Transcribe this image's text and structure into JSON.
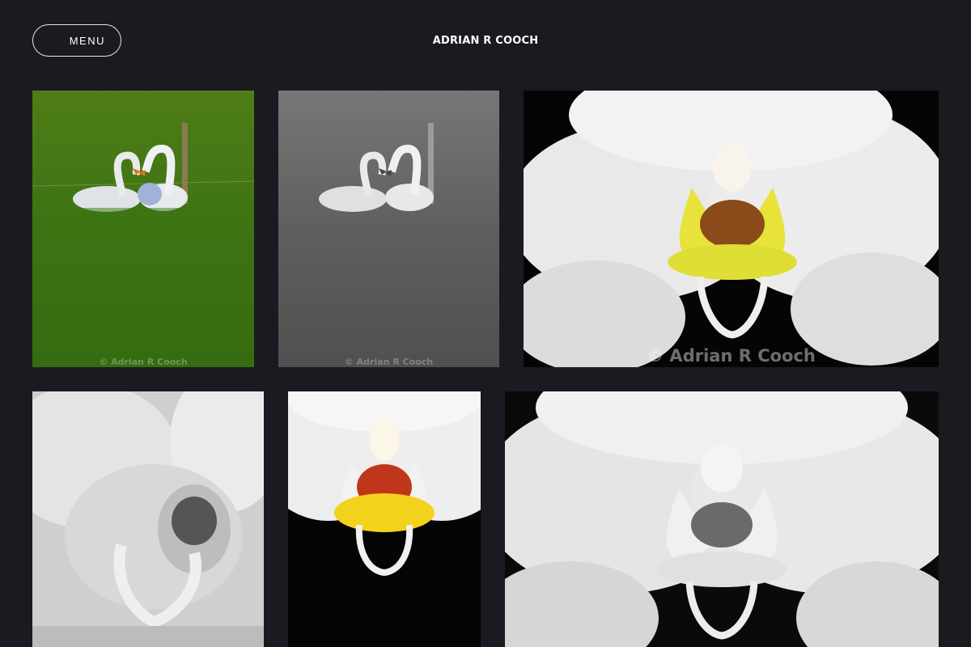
{
  "header": {
    "menu_label": "MENU",
    "site_title": "ADRIAN R COOCH"
  },
  "gallery": {
    "tiles": [
      {
        "subject": "swans-color",
        "watermark": "© Adrian R Cooch"
      },
      {
        "subject": "swans-mono",
        "watermark": "© Adrian R Cooch"
      },
      {
        "subject": "orchid-color",
        "watermark": "© Adrian R Cooch"
      },
      {
        "subject": "orchid-closeup-mono",
        "watermark": ""
      },
      {
        "subject": "orchid-color-narrow",
        "watermark": ""
      },
      {
        "subject": "orchid-mono",
        "watermark": ""
      }
    ]
  },
  "colors": {
    "background": "#1b1a20",
    "text": "#ffffff",
    "menu_border": "#e6e6e6"
  }
}
